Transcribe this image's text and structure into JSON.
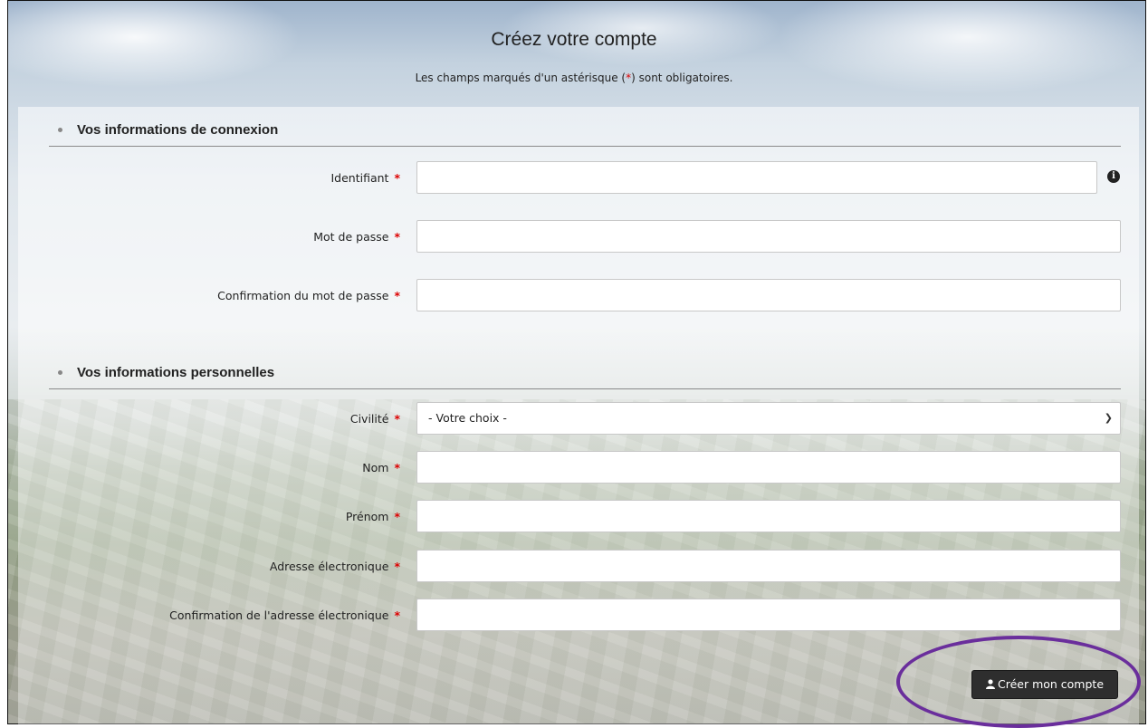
{
  "page": {
    "title": "Créez votre compte",
    "subtitle_before": "Les champs marqués d'un astérisque (",
    "subtitle_star": "*",
    "subtitle_after": ") sont obligatoires."
  },
  "sections": {
    "connexion": {
      "heading": "Vos informations de connexion",
      "fields": {
        "identifiant": {
          "label": "Identifiant",
          "value": "",
          "required": "*"
        },
        "mot_de_passe": {
          "label": "Mot de passe",
          "value": "",
          "required": "*"
        },
        "confirmation_mdp": {
          "label": "Confirmation du mot de passe",
          "value": "",
          "required": "*"
        }
      },
      "info_icon": "i"
    },
    "personnelles": {
      "heading": "Vos informations personnelles",
      "fields": {
        "civilite": {
          "label": "Civilité",
          "selected": "- Votre choix -",
          "required": "*"
        },
        "nom": {
          "label": "Nom",
          "value": "",
          "required": "*"
        },
        "prenom": {
          "label": "Prénom",
          "value": "",
          "required": "*"
        },
        "email": {
          "label": "Adresse électronique",
          "value": "",
          "required": "*"
        },
        "confirmation_email": {
          "label": "Confirmation de l'adresse électronique",
          "value": "",
          "required": "*"
        }
      }
    }
  },
  "actions": {
    "submit_label": "Créer mon compte",
    "submit_icon": "user-icon"
  },
  "colors": {
    "required": "#dd0000",
    "button_bg": "#2e2e2e",
    "highlight": "#6a2e9c"
  }
}
